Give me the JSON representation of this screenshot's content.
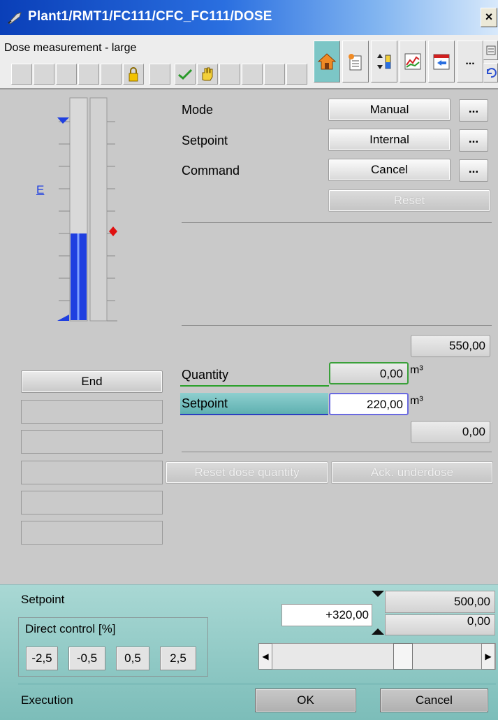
{
  "window": {
    "title": "Plant1/RMT1/FC111/CFC_FC111/DOSE",
    "close_label": "×"
  },
  "header": {
    "title": "Dose measurement - large",
    "more_label": "..."
  },
  "bar": {
    "fill_fraction": 0.39,
    "scale_link": "E"
  },
  "controls": {
    "mode_label": "Mode",
    "mode_value": "Manual",
    "setpoint_label": "Setpoint",
    "setpoint_value": "Internal",
    "command_label": "Command",
    "command_value": "Cancel",
    "dots_label": "...",
    "reset_label": "Reset"
  },
  "dose": {
    "high_limit": "550,00",
    "status_end": "End",
    "quantity_label": "Quantity",
    "quantity_value": "0,00",
    "setpoint_label": "Setpoint",
    "setpoint_value": "220,00",
    "unit": "m³",
    "low_limit": "0,00",
    "reset_dose_label": "Reset dose quantity",
    "ack_underdose_label": "Ack. underdose"
  },
  "footer": {
    "setpoint_label": "Setpoint",
    "setpoint_entry": "+320,00",
    "high_value": "500,00",
    "low_value": "0,00",
    "direct_control_label": "Direct control [%]",
    "step_buttons": [
      "-2,5",
      "-0,5",
      "0,5",
      "2,5"
    ],
    "slider_fraction": 0.64,
    "execution_label": "Execution",
    "ok_label": "OK",
    "cancel_label": "Cancel"
  },
  "colors": {
    "accent": "#7cc6c6",
    "bar_fill": "#1f3fe0",
    "setpoint_marker": "#e01010"
  }
}
